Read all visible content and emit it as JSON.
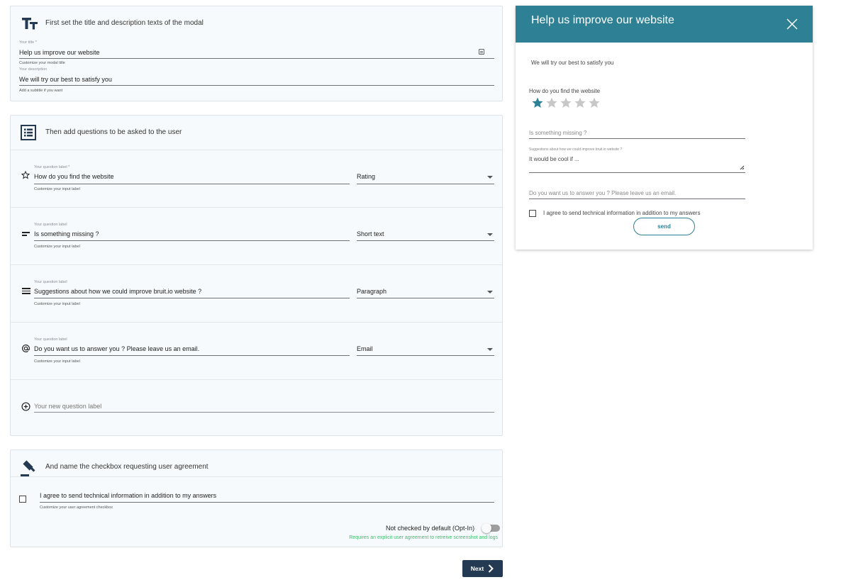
{
  "title_section": {
    "heading": "First set the title and description texts of the modal",
    "title_label": "Your title *",
    "title_value": "Help us improve our website",
    "title_hint": "Customize your modal title",
    "desc_label": "Your description",
    "desc_value": "We will try our best to satisfy you",
    "desc_hint": "Add a subtitle if you want",
    "icon": "text-format-icon"
  },
  "questions_section": {
    "heading": "Then add questions to be asked to the user",
    "icon": "list-icon",
    "questions": [
      {
        "label_caption": "Your question label *",
        "value": "How do you find the website",
        "hint": "Customize your input label",
        "type": "Rating",
        "icon": "star-outline-icon"
      },
      {
        "label_caption": "Your question label",
        "value": "Is something missing ?",
        "hint": "Customize your input label",
        "type": "Short text",
        "icon": "short-text-icon"
      },
      {
        "label_caption": "Your question label",
        "value": "Suggestions about how we could improve bruit.io website ?",
        "hint": "Customize your input label",
        "type": "Paragraph",
        "icon": "paragraph-icon"
      },
      {
        "label_caption": "Your question label",
        "value": "Do you want us to answer you ? Please leave us an email.",
        "hint": "Customize your input label",
        "type": "Email",
        "icon": "at-sign-icon"
      }
    ],
    "new_question_placeholder": "Your new question label"
  },
  "agreement_section": {
    "heading": "And name the checkbox requesting user agreement",
    "icon": "gavel-icon",
    "checkbox_label": "I agree to send technical information in addition to my answers",
    "checkbox_hint": "Customize your user agreement checkbox",
    "toggle_label": "Not checked by default (Opt-In)",
    "toggle_note": "Requires an explicit user agreement to retreive screenshot and logs",
    "toggle_on": false
  },
  "next_button": "Next",
  "modal": {
    "title": "Help us improve our website",
    "description": "We will try our best to satisfy you",
    "rating_label": "How do you find the website",
    "rating_value": 1,
    "rating_max": 5,
    "missing_placeholder": "Is something missing ?",
    "suggestions_label": "Suggestions about how we could improve bruit.io website ?",
    "suggestions_placeholder": "It would be cool if ...",
    "email_placeholder": "Do you want us to answer you ? Please leave us an email.",
    "agreement_label": "I agree to send technical information in addition to my answers",
    "send_label": "send"
  },
  "colors": {
    "accent": "#2e8195",
    "dark_button": "#243a52",
    "note_green": "#3bbf6b",
    "star_filled": "#2e8195",
    "star_empty": "#c8c8c8"
  }
}
